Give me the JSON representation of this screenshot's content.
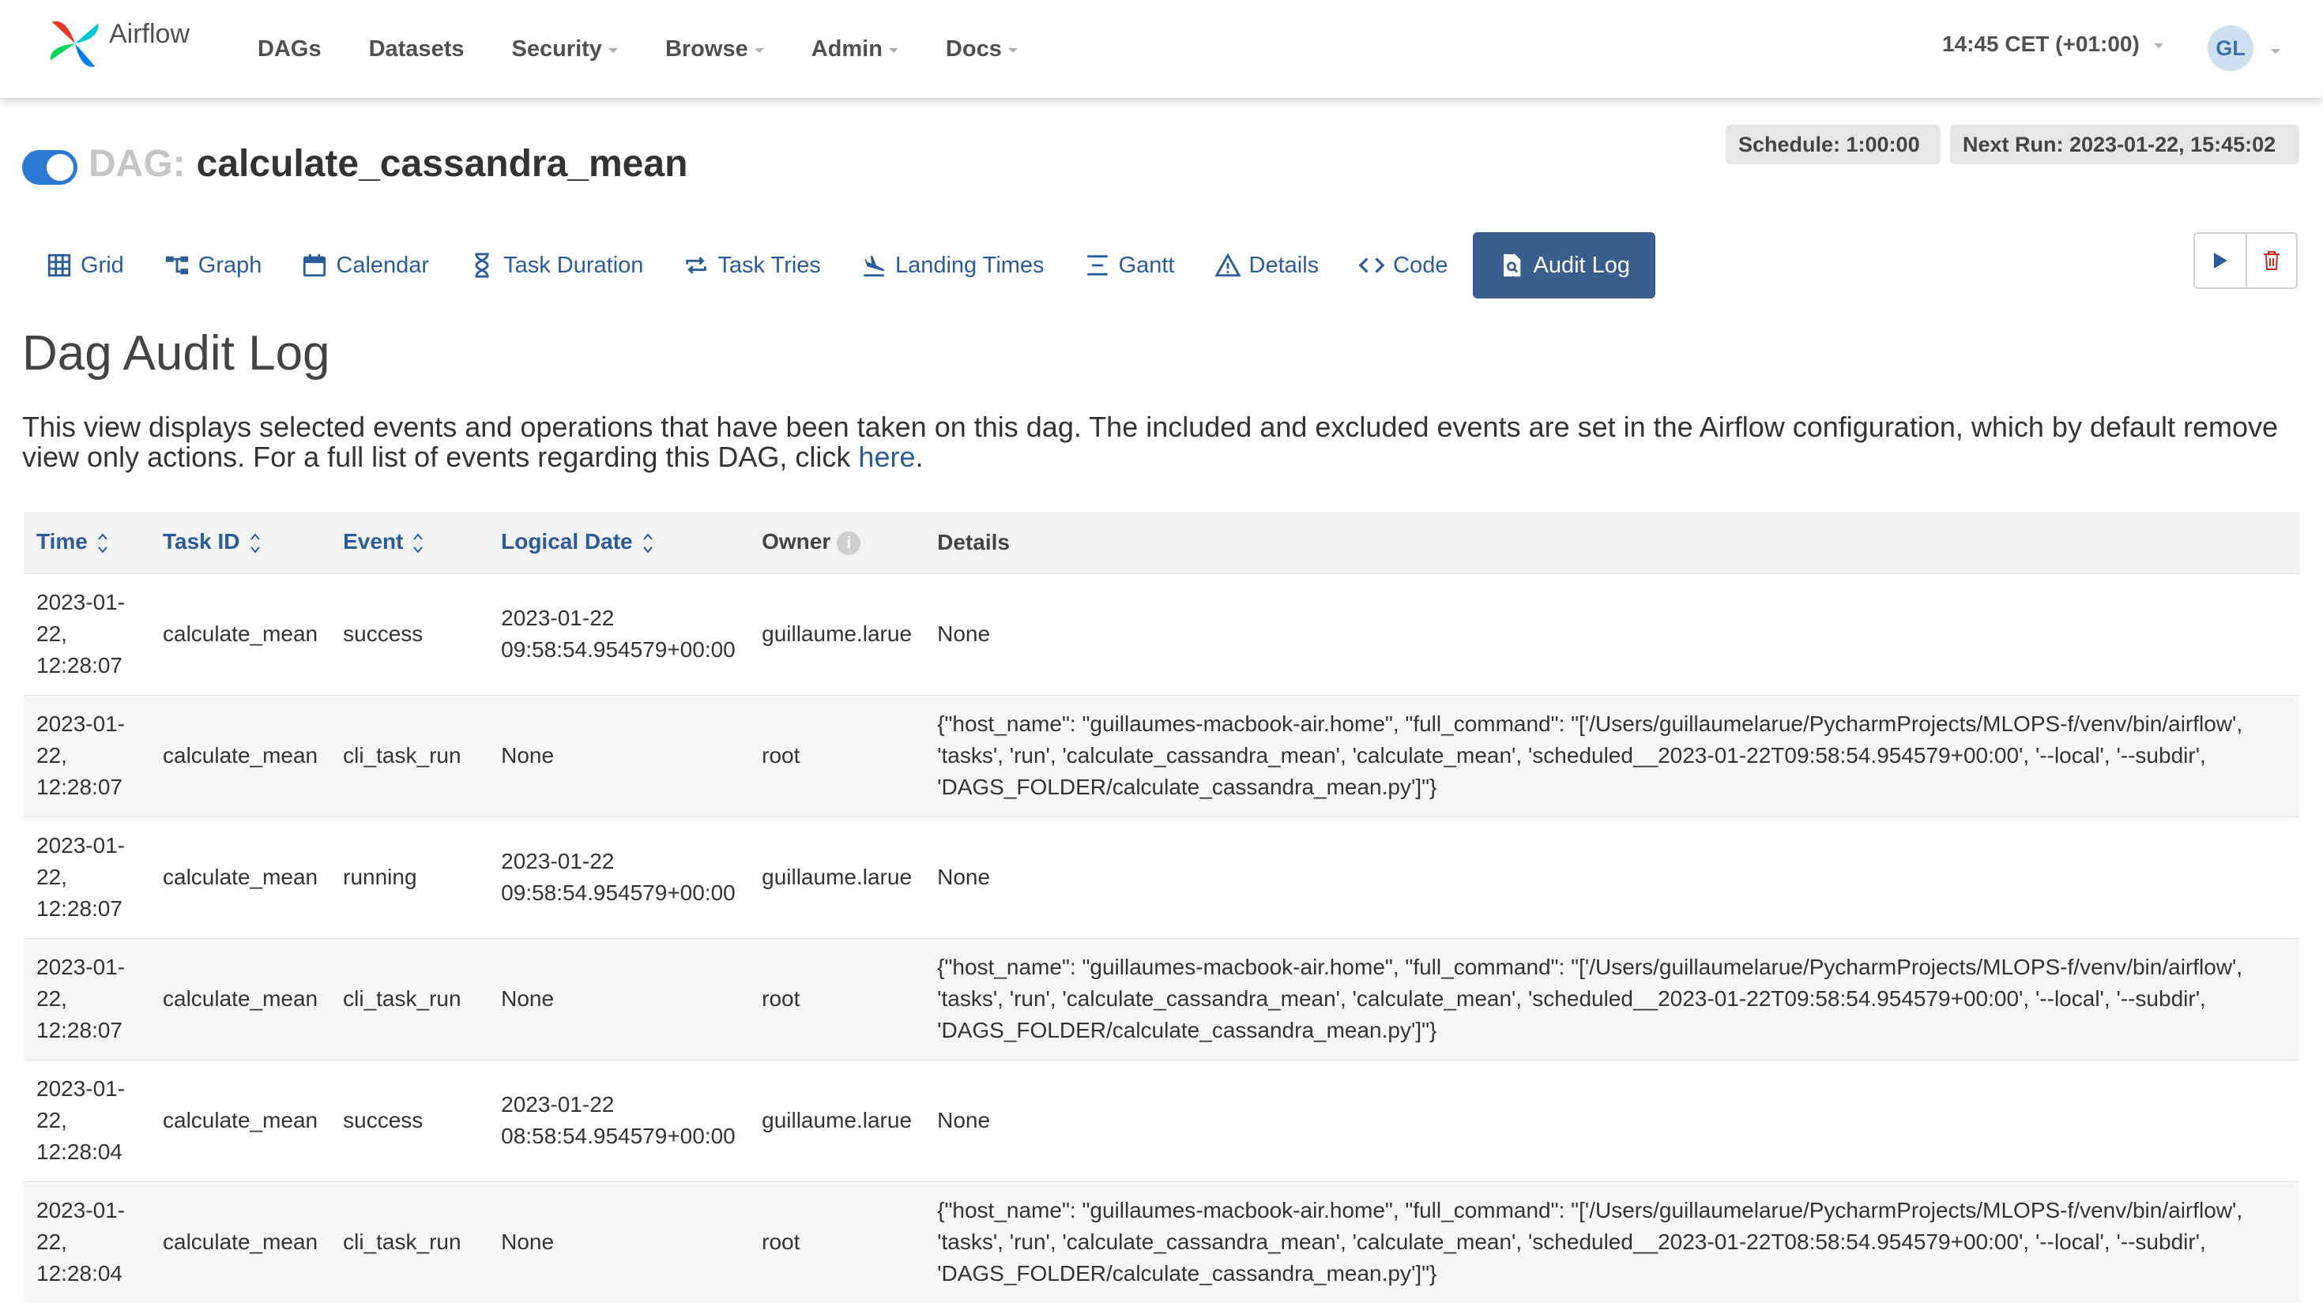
{
  "navbar": {
    "brand": "Airflow",
    "links": [
      {
        "label": "DAGs",
        "dropdown": false
      },
      {
        "label": "Datasets",
        "dropdown": false
      },
      {
        "label": "Security",
        "dropdown": true
      },
      {
        "label": "Browse",
        "dropdown": true
      },
      {
        "label": "Admin",
        "dropdown": true
      },
      {
        "label": "Docs",
        "dropdown": true
      }
    ],
    "clock": "14:45 CET (+01:00)",
    "user_initials": "GL"
  },
  "dag": {
    "prefix": "DAG:",
    "name": "calculate_cassandra_mean",
    "paused": false,
    "schedule": "Schedule: 1:00:00",
    "next_run": "Next Run: 2023-01-22, 15:45:02"
  },
  "tabs": [
    {
      "label": "Grid",
      "icon": "grid-icon",
      "active": false
    },
    {
      "label": "Graph",
      "icon": "graph-icon",
      "active": false
    },
    {
      "label": "Calendar",
      "icon": "calendar-icon",
      "active": false
    },
    {
      "label": "Task Duration",
      "icon": "hourglass-icon",
      "active": false
    },
    {
      "label": "Task Tries",
      "icon": "repeat-icon",
      "active": false
    },
    {
      "label": "Landing Times",
      "icon": "plane-landing-icon",
      "active": false
    },
    {
      "label": "Gantt",
      "icon": "gantt-icon",
      "active": false
    },
    {
      "label": "Details",
      "icon": "warning-triangle-icon",
      "active": false
    },
    {
      "label": "Code",
      "icon": "code-icon",
      "active": false
    },
    {
      "label": "Audit Log",
      "icon": "file-search-icon",
      "active": true
    }
  ],
  "page": {
    "heading": "Dag Audit Log",
    "intro_text": "This view displays selected events and operations that have been taken on this dag. The included and excluded events are set in the Airflow configuration, which by default remove view only actions. For a full list of events regarding this DAG, click ",
    "intro_link": "here",
    "intro_end": "."
  },
  "colors": {
    "accent": "#2a5c9a",
    "active_tab": "#3a5f8e",
    "toggle": "#2d78d2",
    "delete": "#cc2222"
  },
  "table": {
    "columns": [
      {
        "label": "Time",
        "sortable": true
      },
      {
        "label": "Task ID",
        "sortable": true
      },
      {
        "label": "Event",
        "sortable": true
      },
      {
        "label": "Logical Date",
        "sortable": true
      },
      {
        "label": "Owner",
        "sortable": false,
        "info": true
      },
      {
        "label": "Details",
        "sortable": false
      }
    ],
    "rows": [
      {
        "time": "2023-01-22, 12:28:07",
        "task_id": "calculate_mean",
        "event": "success",
        "logical_date": "2023-01-22 09:58:54.954579+00:00",
        "owner": "guillaume.larue",
        "details": "None"
      },
      {
        "time": "2023-01-22, 12:28:07",
        "task_id": "calculate_mean",
        "event": "cli_task_run",
        "logical_date": "None",
        "owner": "root",
        "details": "{\"host_name\": \"guillaumes-macbook-air.home\", \"full_command\": \"['/Users/guillaumelarue/PycharmProjects/MLOPS-f/venv/bin/airflow', 'tasks', 'run', 'calculate_cassandra_mean', 'calculate_mean', 'scheduled__2023-01-22T09:58:54.954579+00:00', '--local', '--subdir', 'DAGS_FOLDER/calculate_cassandra_mean.py']\"}"
      },
      {
        "time": "2023-01-22, 12:28:07",
        "task_id": "calculate_mean",
        "event": "running",
        "logical_date": "2023-01-22 09:58:54.954579+00:00",
        "owner": "guillaume.larue",
        "details": "None"
      },
      {
        "time": "2023-01-22, 12:28:07",
        "task_id": "calculate_mean",
        "event": "cli_task_run",
        "logical_date": "None",
        "owner": "root",
        "details": "{\"host_name\": \"guillaumes-macbook-air.home\", \"full_command\": \"['/Users/guillaumelarue/PycharmProjects/MLOPS-f/venv/bin/airflow', 'tasks', 'run', 'calculate_cassandra_mean', 'calculate_mean', 'scheduled__2023-01-22T09:58:54.954579+00:00', '--local', '--subdir', 'DAGS_FOLDER/calculate_cassandra_mean.py']\"}"
      },
      {
        "time": "2023-01-22, 12:28:04",
        "task_id": "calculate_mean",
        "event": "success",
        "logical_date": "2023-01-22 08:58:54.954579+00:00",
        "owner": "guillaume.larue",
        "details": "None"
      },
      {
        "time": "2023-01-22, 12:28:04",
        "task_id": "calculate_mean",
        "event": "cli_task_run",
        "logical_date": "None",
        "owner": "root",
        "details": "{\"host_name\": \"guillaumes-macbook-air.home\", \"full_command\": \"['/Users/guillaumelarue/PycharmProjects/MLOPS-f/venv/bin/airflow', 'tasks', 'run', 'calculate_cassandra_mean', 'calculate_mean', 'scheduled__2023-01-22T08:58:54.954579+00:00', '--local', '--subdir', 'DAGS_FOLDER/calculate_cassandra_mean.py']\"}"
      }
    ]
  }
}
